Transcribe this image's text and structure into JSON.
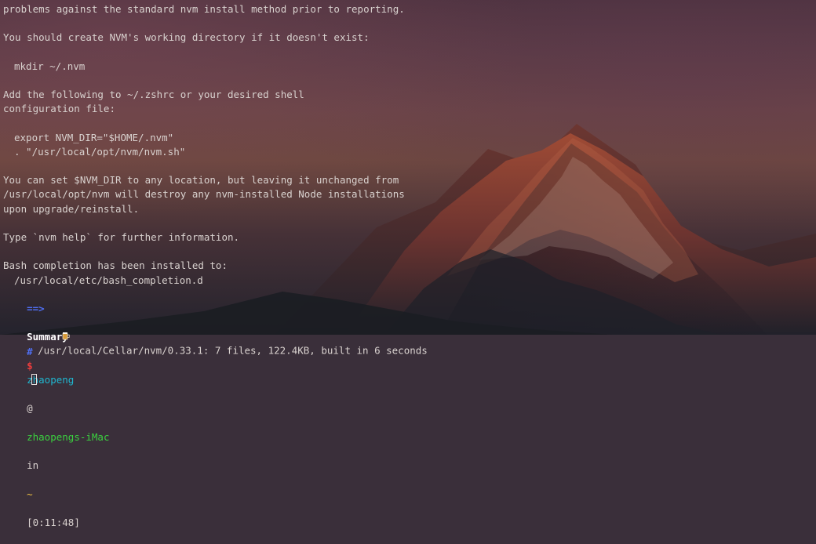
{
  "terminal": {
    "output_lines": [
      "problems against the standard nvm install method prior to reporting.",
      "",
      "You should create NVM's working directory if it doesn't exist:",
      "",
      "mkdir ~/.nvm",
      "",
      "Add the following to ~/.zshrc or your desired shell",
      "configuration file:",
      "",
      "export NVM_DIR=\"$HOME/.nvm\"",
      ". \"/usr/local/opt/nvm/nvm.sh\"",
      "",
      "You can set $NVM_DIR to any location, but leaving it unchanged from",
      "/usr/local/opt/nvm will destroy any nvm-installed Node installations",
      "upon upgrade/reinstall.",
      "",
      "Type `nvm help` for further information.",
      "",
      "Bash completion has been installed to:",
      "/usr/local/etc/bash_completion.d"
    ],
    "summary_arrow": "==>",
    "summary_label": "Summary",
    "summary_detail": "/usr/local/Cellar/nvm/0.33.1: 7 files, 122.4KB, built in 6 seconds",
    "prompt": {
      "hash": "#",
      "user": "zhaopeng",
      "at": "@",
      "host": "zhaopengs-iMac",
      "in": "in",
      "cwd": "~",
      "time": "[0:11:48]",
      "dollar": "$"
    }
  },
  "icons": {
    "beer": "beer-mug-icon"
  },
  "colors": {
    "text": "#d9d2cf",
    "arrow": "#4f6ff2",
    "user": "#1fb7cf",
    "host": "#3ad23f",
    "cwd": "#f0c342",
    "dollar": "#ee3d3d"
  }
}
